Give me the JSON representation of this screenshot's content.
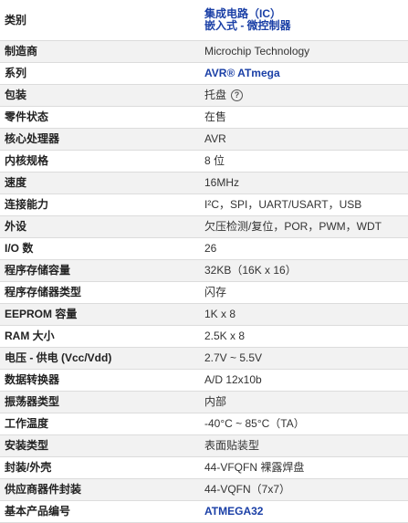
{
  "rows": [
    {
      "label": "类别",
      "links": [
        "集成电路（IC）",
        "嵌入式 - 微控制器"
      ]
    },
    {
      "label": "制造商",
      "value": "Microchip Technology"
    },
    {
      "label": "系列",
      "value": "AVR® ATmega",
      "link": true
    },
    {
      "label": "包装",
      "value": "托盘",
      "help": true
    },
    {
      "label": "零件状态",
      "value": "在售"
    },
    {
      "label": "核心处理器",
      "value": "AVR"
    },
    {
      "label": "内核规格",
      "value": "8 位"
    },
    {
      "label": "速度",
      "value": "16MHz"
    },
    {
      "label": "连接能力",
      "value": "I²C，SPI，UART/USART，USB"
    },
    {
      "label": "外设",
      "value": "欠压检测/复位，POR，PWM，WDT"
    },
    {
      "label": "I/O 数",
      "value": "26"
    },
    {
      "label": "程序存储容量",
      "value": "32KB（16K x 16）"
    },
    {
      "label": "程序存储器类型",
      "value": "闪存"
    },
    {
      "label": "EEPROM 容量",
      "value": "1K x 8"
    },
    {
      "label": "RAM 大小",
      "value": "2.5K x 8"
    },
    {
      "label": "电压 - 供电 (Vcc/Vdd)",
      "value": "2.7V ~ 5.5V"
    },
    {
      "label": "数据转换器",
      "value": "A/D 12x10b"
    },
    {
      "label": "振荡器类型",
      "value": "内部"
    },
    {
      "label": "工作温度",
      "value": "-40°C ~ 85°C（TA）"
    },
    {
      "label": "安装类型",
      "value": "表面贴装型"
    },
    {
      "label": "封装/外壳",
      "value": "44-VFQFN 裸露焊盘"
    },
    {
      "label": "供应商器件封装",
      "value": "44-VQFN（7x7）"
    },
    {
      "label": "基本产品编号",
      "value": "ATMEGA32",
      "link": true
    }
  ],
  "help_icon": "question-circle-icon"
}
